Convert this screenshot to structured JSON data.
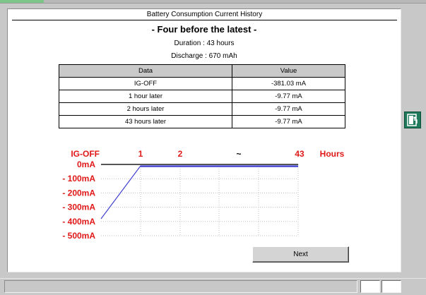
{
  "window": {
    "title": "Battery Consumption Current History",
    "subtitle": "- Four before the latest -"
  },
  "summary": {
    "duration": "Duration : 43 hours",
    "discharge": "Discharge : 670 mAh"
  },
  "table": {
    "headers": [
      "Data",
      "Value"
    ],
    "rows": [
      {
        "data": "IG-OFF",
        "value": "-381.03 mA"
      },
      {
        "data": "1 hour later",
        "value": "-9.77 mA"
      },
      {
        "data": "2 hours later",
        "value": "-9.77 mA"
      },
      {
        "data": "43 hours later",
        "value": "-9.77 mA"
      }
    ]
  },
  "chart_data": {
    "type": "line",
    "x_tick_labels": [
      "IG-OFF",
      "1",
      "2",
      "~",
      "43"
    ],
    "x_unit_label": "Hours",
    "y_tick_labels": [
      "0mA",
      "- 100mA",
      "- 200mA",
      "- 300mA",
      "- 400mA",
      "- 500mA"
    ],
    "ylim": [
      -500,
      0
    ],
    "grid": true,
    "series": [
      {
        "x": [
          "IG-OFF",
          "1",
          "2",
          "~",
          "43"
        ],
        "values": [
          -381.03,
          -9.77,
          -9.77,
          -9.77,
          -9.77
        ]
      }
    ],
    "colors": {
      "labels": "#e01818",
      "line": "#4040d0",
      "axis": "#555555",
      "grid": "#c0c0c0"
    }
  },
  "buttons": {
    "next_label": "Next",
    "exit_icon": "exit-door-icon"
  },
  "colors": {
    "accent_red": "#e01818",
    "exit_green": "#1f7a5c"
  }
}
